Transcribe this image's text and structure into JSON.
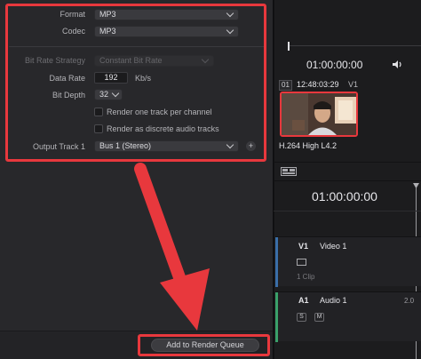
{
  "render_settings": {
    "format": {
      "label": "Format",
      "value": "MP3"
    },
    "codec": {
      "label": "Codec",
      "value": "MP3"
    },
    "bit_rate_strategy": {
      "label": "Bit Rate Strategy",
      "value": "Constant Bit Rate"
    },
    "data_rate": {
      "label": "Data Rate",
      "value": "192",
      "unit": "Kb/s"
    },
    "bit_depth": {
      "label": "Bit Depth",
      "value": "32"
    },
    "checkboxes": [
      {
        "label": "Render one track per channel",
        "checked": false
      },
      {
        "label": "Render as discrete audio tracks",
        "checked": false
      }
    ],
    "output_track": {
      "label": "Output Track 1",
      "value": "Bus 1 (Stereo)"
    },
    "add_track_glyph": "+"
  },
  "render_button": {
    "label": "Add to Render Queue"
  },
  "viewer": {
    "timecode": "01:00:00:00",
    "clip_index": "01",
    "clip_timecode": "12:48:03:29",
    "clip_track": "V1",
    "clip_codec": "H.264 High L4.2"
  },
  "timeline": {
    "timecode": "01:00:00:00",
    "video_track": {
      "tag": "V1",
      "name": "Video 1",
      "clip_count": "1 Clip"
    },
    "audio_track": {
      "tag": "A1",
      "name": "Audio 1",
      "channels": "2.0",
      "solo": "S",
      "mute": "M"
    }
  },
  "colors": {
    "annotation_red": "#e8383d",
    "panel_bg": "#28282b",
    "audio_track": "#3aa06a",
    "video_track": "#3a6ea8"
  },
  "icons": [
    "chevron-down-icon",
    "speaker-icon",
    "clip-thumbnail-icon",
    "timeline-view-icon",
    "arrow-annotation"
  ]
}
